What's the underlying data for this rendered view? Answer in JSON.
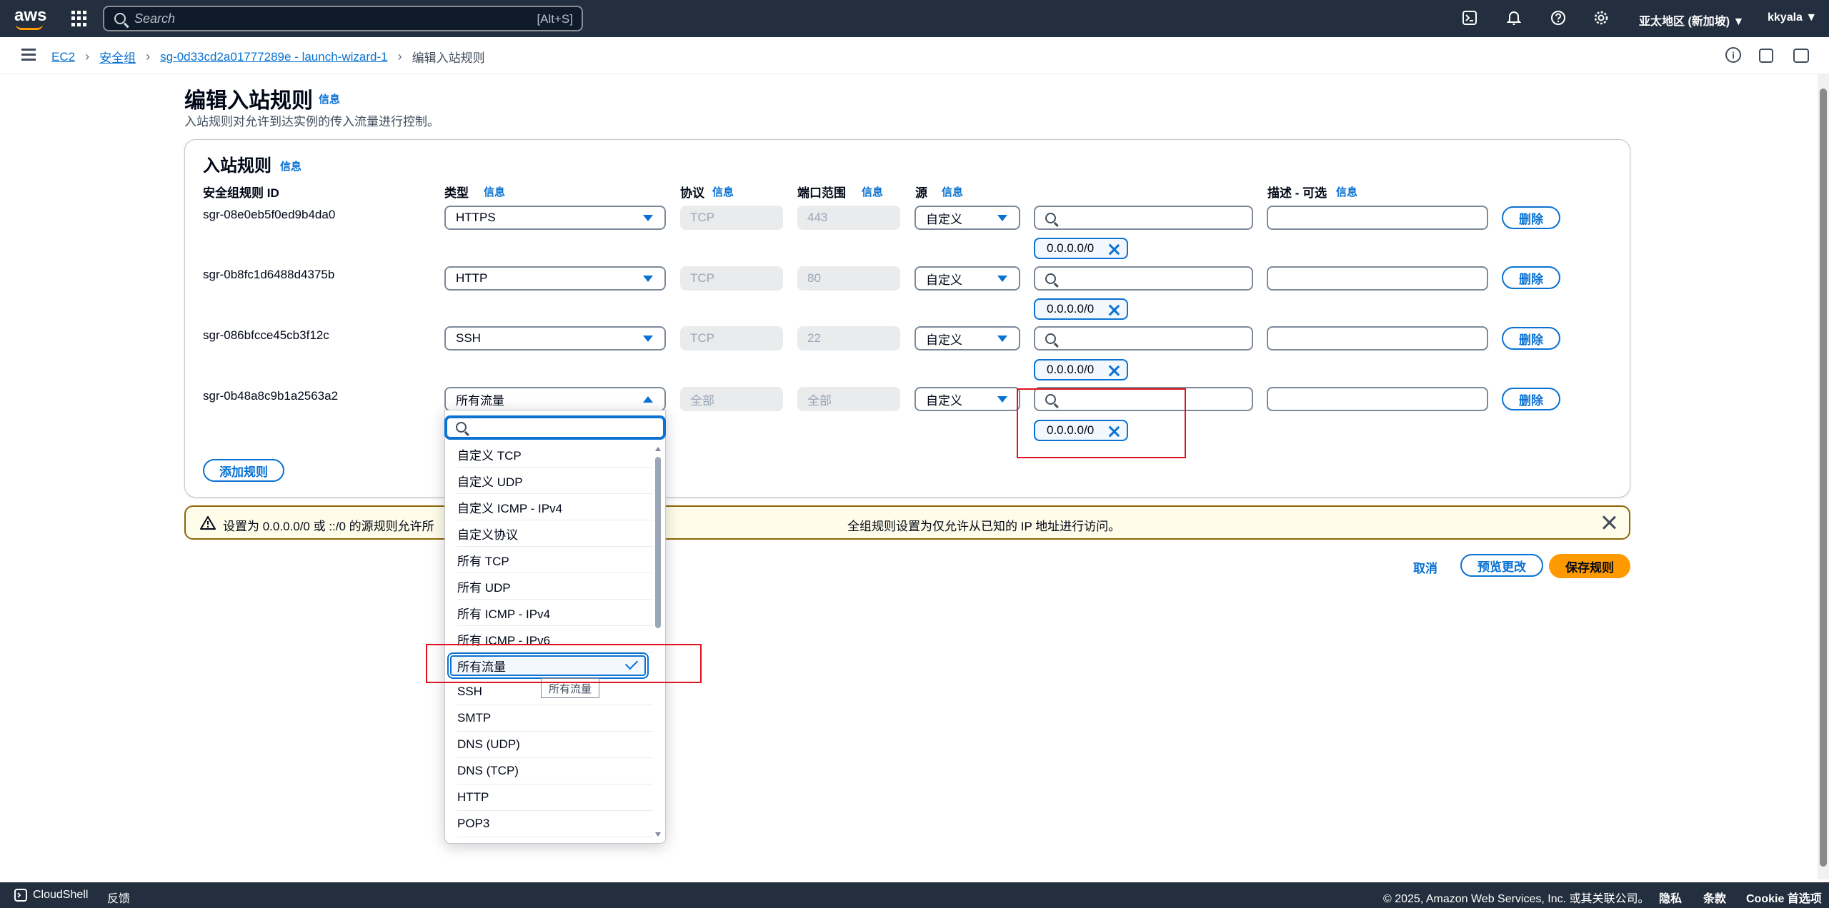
{
  "topnav": {
    "logo": "aws",
    "search_placeholder": "Search",
    "search_shortcut": "[Alt+S]",
    "region": "亚太地区 (新加坡) ▼",
    "user": "kkyala ▼"
  },
  "breadcrumb": {
    "items": [
      "EC2",
      "安全组",
      "sg-0d33cd2a01777289e - launch-wizard-1"
    ],
    "current": "编辑入站规则"
  },
  "page": {
    "title": "编辑入站规则",
    "info": "信息",
    "subtitle": "入站规则对允许到达实例的传入流量进行控制。"
  },
  "panel": {
    "title": "入站规则",
    "info": "信息",
    "columns": {
      "rule_id": "安全组规则 ID",
      "type": "类型",
      "protocol": "协议",
      "port_range": "端口范围",
      "source": "源",
      "description": "描述 - 可选"
    },
    "rules": [
      {
        "id": "sgr-08e0eb5f0ed9b4da0",
        "type": "HTTPS",
        "protocol": "TCP",
        "port": "443",
        "source": "自定义",
        "cidr": "0.0.0.0/0"
      },
      {
        "id": "sgr-0b8fc1d6488d4375b",
        "type": "HTTP",
        "protocol": "TCP",
        "port": "80",
        "source": "自定义",
        "cidr": "0.0.0.0/0"
      },
      {
        "id": "sgr-086bfcce45cb3f12c",
        "type": "SSH",
        "protocol": "TCP",
        "port": "22",
        "source": "自定义",
        "cidr": "0.0.0.0/0"
      },
      {
        "id": "sgr-0b48a8c9b1a2563a2",
        "type": "所有流量",
        "protocol": "全部",
        "port": "全部",
        "source": "自定义",
        "cidr": "0.0.0.0/0"
      }
    ],
    "delete_label": "删除",
    "add_rule": "添加规则"
  },
  "alert": {
    "text": "设置为 0.0.0.0/0 或 ::/0 的源规则允许所",
    "text2": "全组规则设置为仅允许从已知的 IP 地址进行访问。"
  },
  "actions": {
    "cancel": "取消",
    "preview": "预览更改",
    "save": "保存规则"
  },
  "dropdown": {
    "options": [
      "自定义 TCP",
      "自定义 UDP",
      "自定义 ICMP - IPv4",
      "自定义协议",
      "所有 TCP",
      "所有 UDP",
      "所有 ICMP - IPv4",
      "所有 ICMP - IPv6",
      "所有流量",
      "SSH",
      "SMTP",
      "DNS (UDP)",
      "DNS (TCP)",
      "HTTP",
      "POP3"
    ],
    "selected": "所有流量",
    "tooltip": "所有流量"
  },
  "footer": {
    "cloudshell": "CloudShell",
    "feedback": "反馈",
    "copyright": "© 2025, Amazon Web Services, Inc. 或其关联公司。",
    "privacy": "隐私",
    "terms": "条款",
    "cookie": "Cookie 首选项"
  }
}
